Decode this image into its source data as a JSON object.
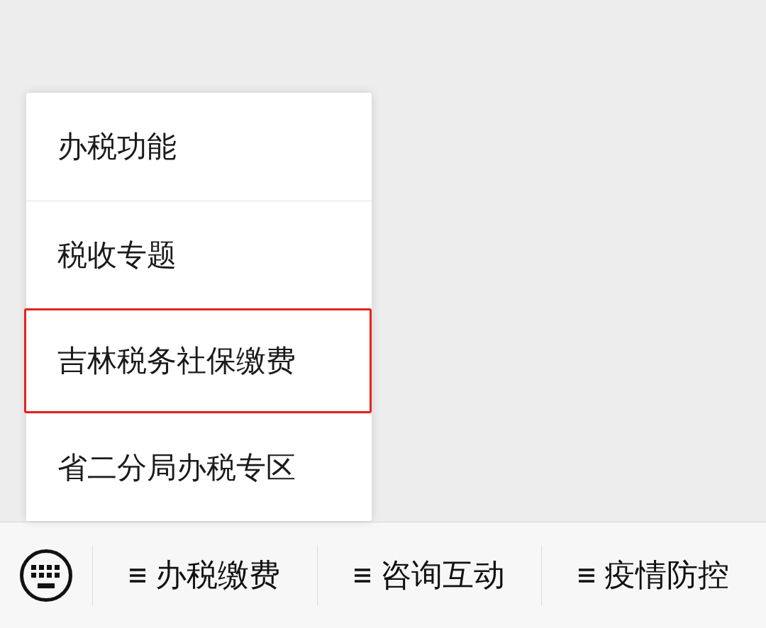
{
  "submenu": {
    "items": [
      {
        "label": "办税功能",
        "highlighted": false
      },
      {
        "label": "税收专题",
        "highlighted": false
      },
      {
        "label": "吉林税务社保缴费",
        "highlighted": true
      },
      {
        "label": "省二分局办税专区",
        "highlighted": false
      }
    ]
  },
  "menu_bar": {
    "items": [
      {
        "label": "办税缴费"
      },
      {
        "label": "咨询互动"
      },
      {
        "label": "疫情防控"
      }
    ]
  }
}
